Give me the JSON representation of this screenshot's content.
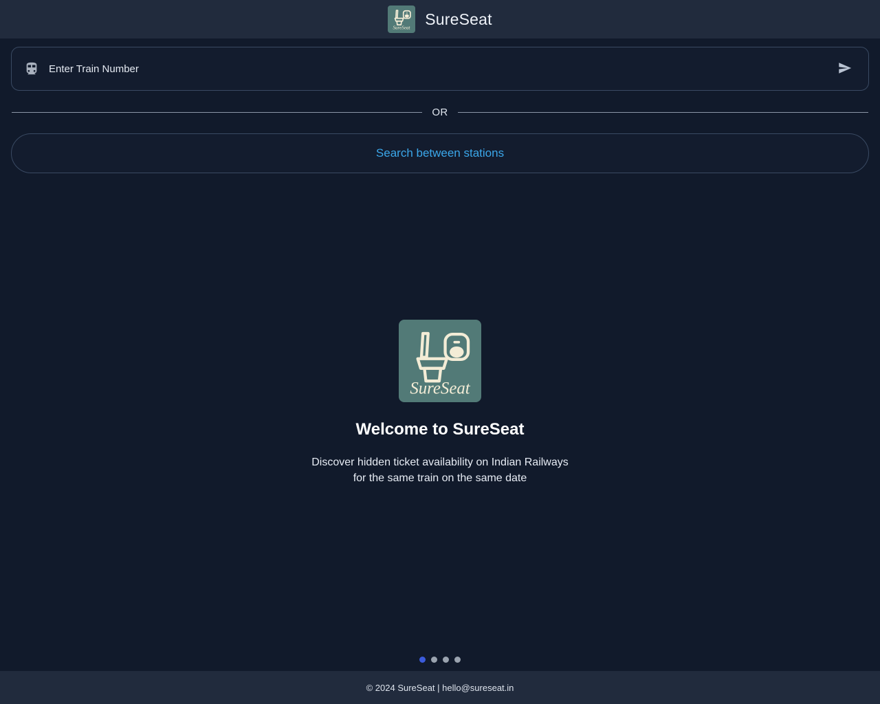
{
  "header": {
    "title": "SureSeat",
    "logo_icon": "sureseat-toilet-logo",
    "logo_bg": "#527a77",
    "logo_fg": "#f3ecd6",
    "bg": "#212b3d"
  },
  "search": {
    "train_icon": "train-icon",
    "placeholder": "Enter Train Number",
    "value": "",
    "submit_icon": "send-icon"
  },
  "divider": {
    "label": "OR"
  },
  "stations": {
    "label": "Search between stations",
    "color": "#3ba7ea"
  },
  "hero": {
    "logo_icon": "sureseat-toilet-logo",
    "logo_wordmark": "SureSeat",
    "title": "Welcome to SureSeat",
    "subtitle_line1": "Discover hidden ticket availability on Indian Railways",
    "subtitle_line2": "for the same train on the same date"
  },
  "carousel": {
    "active_index": 0,
    "active_color": "#3b5bdb",
    "inactive_color": "#9aa3af",
    "dots": [
      "slide-1",
      "slide-2",
      "slide-3",
      "slide-4"
    ]
  },
  "footer": {
    "text": "© 2024 SureSeat | hello@sureseat.in",
    "bg": "#212b3d"
  },
  "theme": {
    "page_bg": "#111a2b",
    "panel_bg": "#131c2e",
    "border": "#3a4a63",
    "text": "#e8edf5"
  }
}
